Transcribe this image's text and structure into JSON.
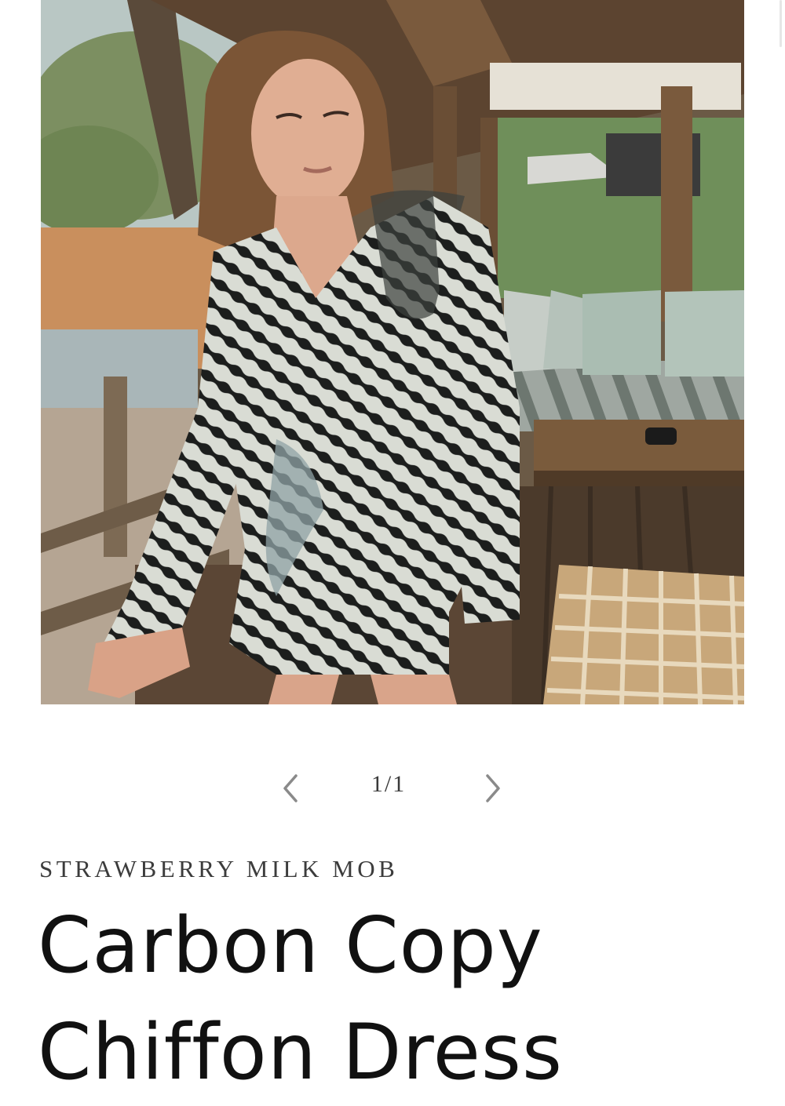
{
  "product": {
    "image_alt": "Woman wearing a zebra-print ruffled chiffon mini dress on a safari lodge deck",
    "vendor": "STRAWBERRY MILK MOB",
    "title": "Carbon Copy Chiffon Dress"
  },
  "slider": {
    "counter": "1/1",
    "prev_icon": "chevron-left-icon",
    "next_icon": "chevron-right-icon"
  },
  "colors": {
    "text": "#121212",
    "muted": "#3c3c3c",
    "background": "#ffffff"
  }
}
